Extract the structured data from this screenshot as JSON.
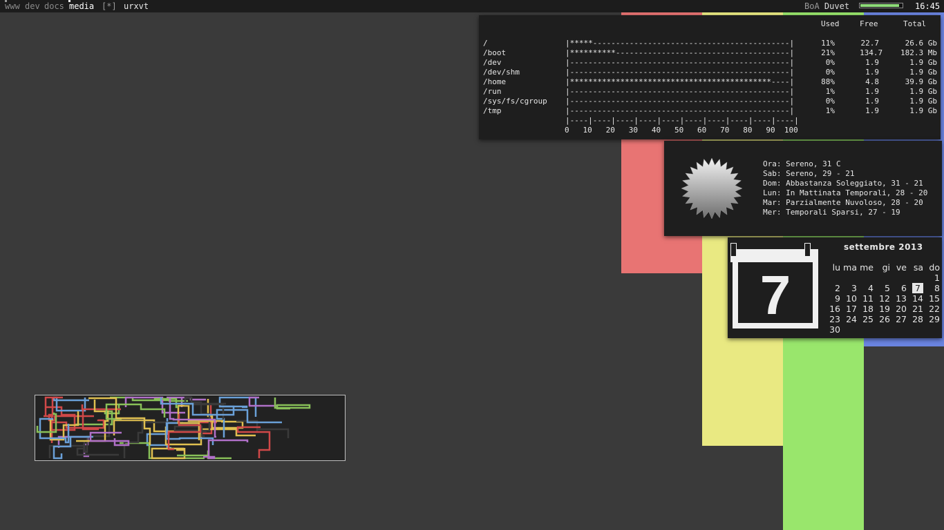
{
  "colors": {
    "desktop": "#3a3a3a",
    "stripe_red": "#e87473",
    "stripe_yellow": "#e9e982",
    "stripe_green": "#99e66c",
    "stripe_blue": "#6a84e0",
    "panel": "#1e1e1e"
  },
  "bar": {
    "workspaces": [
      {
        "label": "www",
        "state": "occupied"
      },
      {
        "label": "dev",
        "state": "occupied"
      },
      {
        "label": "docs",
        "state": "occupied"
      },
      {
        "label": "media",
        "state": "current"
      }
    ],
    "layout": "[*]",
    "window_title": "urxvt",
    "song_artist": "BoA",
    "song_title": "Duvet",
    "volume_percent": 90,
    "clock": "16:45"
  },
  "disk": {
    "header": {
      "used": "Used",
      "free": "Free",
      "total": "Total"
    },
    "rows": [
      {
        "mount": "/",
        "bar": "|*****-------------------------------------------|",
        "used": "11%",
        "free": "22.7",
        "total": "26.6 Gb"
      },
      {
        "mount": "/boot",
        "bar": "|**********--------------------------------------|",
        "used": "21%",
        "free": "134.7",
        "total": "182.3 Mb"
      },
      {
        "mount": "/dev",
        "bar": "|------------------------------------------------|",
        "used": "0%",
        "free": "1.9",
        "total": "1.9 Gb"
      },
      {
        "mount": "/dev/shm",
        "bar": "|------------------------------------------------|",
        "used": "0%",
        "free": "1.9",
        "total": "1.9 Gb"
      },
      {
        "mount": "/home",
        "bar": "|********************************************----|",
        "used": "88%",
        "free": "4.8",
        "total": "39.9 Gb"
      },
      {
        "mount": "/run",
        "bar": "|------------------------------------------------|",
        "used": "1%",
        "free": "1.9",
        "total": "1.9 Gb"
      },
      {
        "mount": "/sys/fs/cgroup",
        "bar": "|------------------------------------------------|",
        "used": "0%",
        "free": "1.9",
        "total": "1.9 Gb"
      },
      {
        "mount": "/tmp",
        "bar": "|------------------------------------------------|",
        "used": "1%",
        "free": "1.9",
        "total": "1.9 Gb"
      }
    ],
    "scale_line": "|----|----|----|----|----|----|----|----|----|----|",
    "scale_labels": "0   10   20   30   40   50   60   70   80   90  100"
  },
  "weather": {
    "icon": "sun-icon",
    "lines": [
      "Ora: Sereno, 31 C",
      "Sab: Sereno, 29 - 21",
      "Dom: Abbastanza Soleggiato, 31 - 21",
      "Lun: In Mattinata Temporali, 28 - 20",
      "Mar: Parzialmente Nuvoloso, 28 - 20",
      "Mer: Temporali Sparsi, 27 - 19"
    ]
  },
  "calendar": {
    "icon": "calendar-icon",
    "big_day": "7",
    "month_title": "settembre 2013",
    "weekdays": [
      "lu",
      "ma",
      "me",
      "gi",
      "ve",
      "sa",
      "do"
    ],
    "weeks": [
      [
        "",
        "",
        "",
        "",
        "",
        "",
        "1"
      ],
      [
        "2",
        "3",
        "4",
        "5",
        "6",
        "7",
        "8"
      ],
      [
        "9",
        "10",
        "11",
        "12",
        "13",
        "14",
        "15"
      ],
      [
        "16",
        "17",
        "18",
        "19",
        "20",
        "21",
        "22"
      ],
      [
        "23",
        "24",
        "25",
        "26",
        "27",
        "28",
        "29"
      ],
      [
        "30",
        "",
        "",
        "",
        "",
        "",
        ""
      ]
    ],
    "today": "7"
  },
  "pipes": {
    "colors": [
      "#e0c050",
      "#d04848",
      "#6aa0d8",
      "#88c058",
      "#b070c8",
      "#3a3a3a"
    ]
  }
}
